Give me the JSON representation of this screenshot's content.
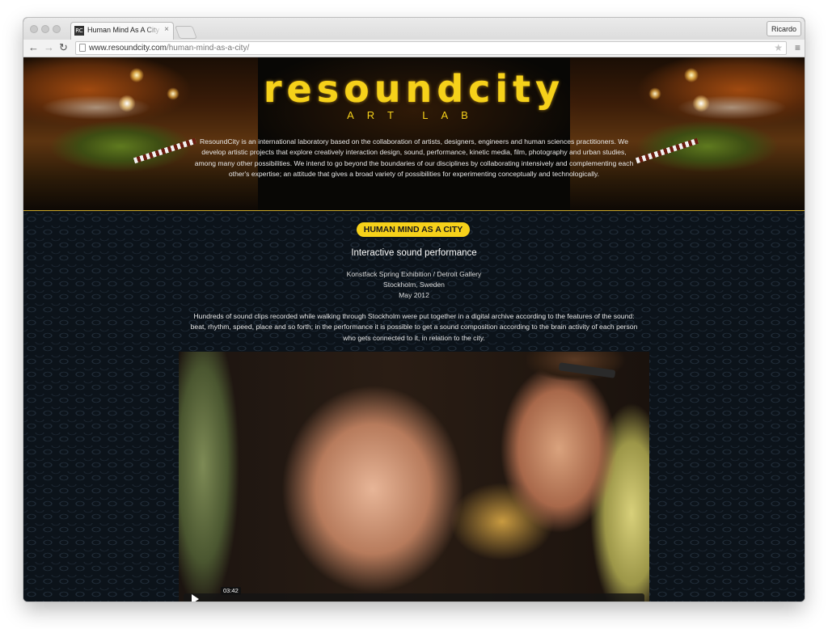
{
  "browser": {
    "tab_title": "Human Mind As A City resoundcity",
    "favicon_text": "RC",
    "tab_close": "×",
    "profile_name": "Ricardo",
    "url_host": "www.resoundcity.com",
    "url_path": "/human-mind-as-a-city/",
    "nav": {
      "back": "←",
      "forward": "→",
      "reload": "↻"
    },
    "star": "★",
    "menu": "≡"
  },
  "hero": {
    "logo": "resoundcity",
    "subtitle": "ART LAB",
    "intro": "ResoundCity is an international laboratory based on the collaboration of artists, designers, engineers and human sciences practitioners. We develop artistic projects that explore creatively interaction design, sound, performance, kinetic media, film, photography and urban studies, among many other possibilities. We intend to go beyond the boundaries of our disciplines by collaborating intensively and complementing each other's expertise; an attitude that gives a broad variety of possibilities for experimenting conceptually and technologically."
  },
  "project": {
    "badge": "HUMAN MIND AS A CITY",
    "subtitle": "Interactive sound performance",
    "meta": [
      "Konstfack Spring Exhibition / Detroit Gallery",
      "Stockholm, Sweden",
      "May 2012"
    ],
    "description": "Hundreds of sound clips recorded while walking through Stockholm were put together in a digital archive according to the features of the sound: beat, rhythm, speed, place and so forth; in the performance it is possible to get a sound composition according to the brain activity of each person who gets connected to it, in relation to the city.",
    "video": {
      "time": "03:42"
    }
  },
  "colors": {
    "accent": "#f6d11a",
    "page_bg": "#0c131a",
    "text": "#e8e8e8"
  }
}
